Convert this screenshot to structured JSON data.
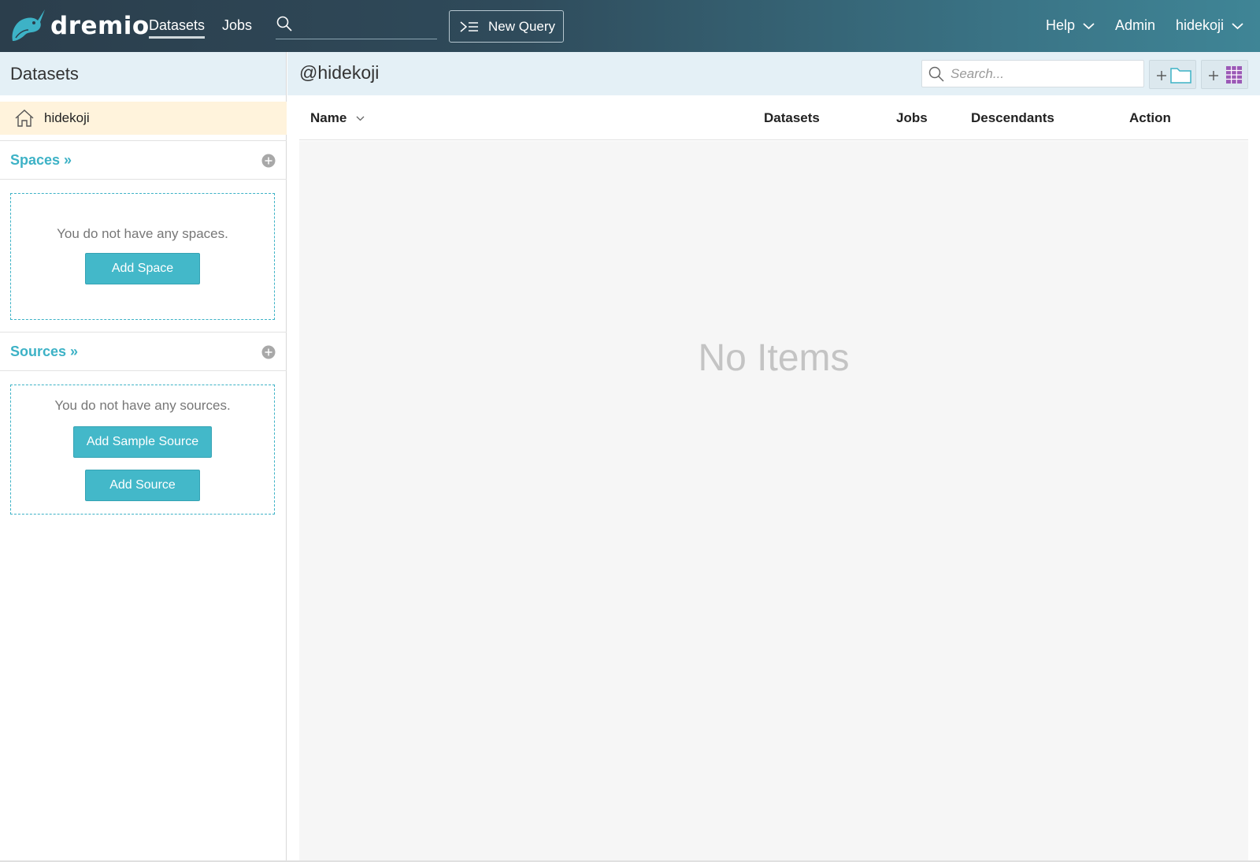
{
  "topbar": {
    "brand": "dremio",
    "nav": {
      "datasets": "Datasets",
      "jobs": "Jobs"
    },
    "search": {
      "placeholder": "",
      "value": ""
    },
    "new_query": "New Query",
    "help": "Help",
    "admin": "Admin",
    "user": "hidekoji"
  },
  "sidebar": {
    "title": "Datasets",
    "home": {
      "label": "hidekoji"
    },
    "spaces": {
      "title": "Spaces »",
      "empty_text": "You do not have any spaces.",
      "add_button": "Add Space"
    },
    "sources": {
      "title": "Sources »",
      "empty_text": "You do not have any sources.",
      "add_sample_button": "Add Sample Source",
      "add_button": "Add Source"
    }
  },
  "main": {
    "title": "@hidekoji",
    "search": {
      "placeholder": "Search...",
      "value": ""
    },
    "columns": {
      "name": "Name",
      "datasets": "Datasets",
      "jobs": "Jobs",
      "descendants": "Descendants",
      "action": "Action"
    },
    "empty_message": "No Items"
  },
  "icons": {
    "logo": "narwhal-logo-icon",
    "search": "search-icon",
    "new_query": "sql-editor-icon",
    "chevron": "chevron-down-icon",
    "home": "home-icon",
    "add_circle": "add-circle-icon",
    "add_folder": "add-folder-icon",
    "add_dataset": "add-dataset-icon"
  },
  "colors": {
    "accent": "#43b8c9",
    "link": "#3db2c6",
    "header_bg": "#e4f0f6",
    "home_row_bg": "#fff3dc",
    "dataset_icon": "#9b59b6"
  }
}
